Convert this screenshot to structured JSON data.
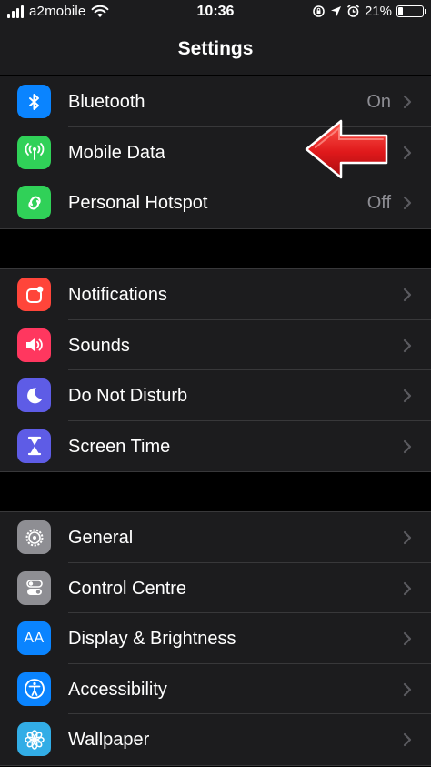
{
  "status_bar": {
    "carrier": "a2mobile",
    "time": "10:36",
    "battery_percent": "21%",
    "battery_level": 0.21
  },
  "nav": {
    "title": "Settings"
  },
  "groups": [
    {
      "items": [
        {
          "label": "Bluetooth",
          "value": "On",
          "icon": "bluetooth-icon",
          "color": "#0a84ff"
        },
        {
          "label": "Mobile Data",
          "value": "",
          "icon": "antenna-icon",
          "color": "#30d158"
        },
        {
          "label": "Personal Hotspot",
          "value": "Off",
          "icon": "hotspot-icon",
          "color": "#30d158"
        }
      ]
    },
    {
      "items": [
        {
          "label": "Notifications",
          "icon": "notifications-icon",
          "color": "#ff453a"
        },
        {
          "label": "Sounds",
          "icon": "speaker-icon",
          "color": "#ff375f"
        },
        {
          "label": "Do Not Disturb",
          "icon": "moon-icon",
          "color": "#5e5ce6"
        },
        {
          "label": "Screen Time",
          "icon": "hourglass-icon",
          "color": "#5e5ce6"
        }
      ]
    },
    {
      "items": [
        {
          "label": "General",
          "icon": "gear-icon",
          "color": "#8e8e93"
        },
        {
          "label": "Control Centre",
          "icon": "toggles-icon",
          "color": "#8e8e93"
        },
        {
          "label": "Display & Brightness",
          "icon": "text-size-icon",
          "icon_text": "AA",
          "color": "#0a84ff"
        },
        {
          "label": "Accessibility",
          "icon": "accessibility-icon",
          "color": "#0a84ff"
        },
        {
          "label": "Wallpaper",
          "icon": "flower-icon",
          "color": "#32ade6"
        }
      ]
    }
  ],
  "annotation": {
    "type": "red-arrow",
    "points_to": "Mobile Data",
    "color": "#e0191b"
  }
}
